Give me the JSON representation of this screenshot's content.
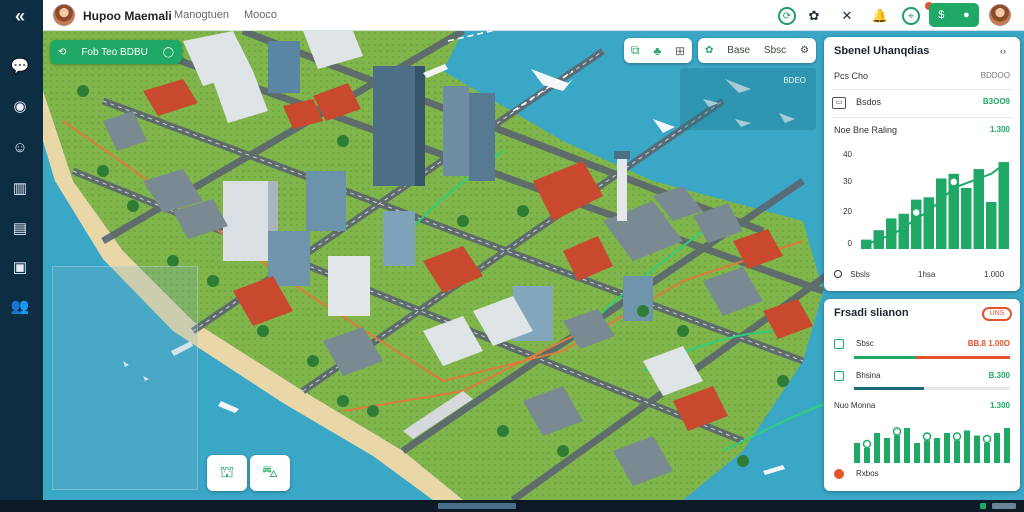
{
  "header": {
    "brand": "Hupoo Maemali",
    "nav": [
      {
        "label": "Manogtuen"
      },
      {
        "label": "Mooco"
      }
    ]
  },
  "map": {
    "search_chip": {
      "label": "Fob Teo BDBU"
    },
    "filter_chip": {
      "label_a": "Base",
      "label_b": "Sbsc"
    },
    "flights_label": "BDEO"
  },
  "panel_traffic": {
    "title": "Sbenel Uhanqdias",
    "close": "‹›",
    "sub_label": "Pcs Cho",
    "sub_value": "BDDOO",
    "rows": [
      {
        "label": "Bsdos",
        "value": "B3OO9"
      }
    ],
    "chart_title": "Noe Bne Raling",
    "chart_value": "1.300",
    "legend": [
      {
        "label": "Sbsls"
      },
      {
        "label": "1hsa"
      },
      {
        "label": "1.000"
      }
    ]
  },
  "panel_status": {
    "title": "Frsadi slianon",
    "pill": "UNS",
    "rows": [
      {
        "label": "Sbsc",
        "v1": "BB.8",
        "v2": "1.00O"
      },
      {
        "label": "Bhsina",
        "v1": "",
        "v2": "B.300"
      },
      {
        "label": "Nuo Monna",
        "v1": "",
        "v2": "1.300"
      }
    ],
    "footer": "Rxbos"
  },
  "colors": {
    "accent": "#1fa866",
    "alert": "#e5532b",
    "rail": "#0c2d42",
    "sea": "#3aa7c7"
  },
  "chart_data": [
    {
      "type": "bar",
      "title": "Noe Bne Raling",
      "ylabel": "",
      "xlabel": "",
      "ylim": [
        0,
        40
      ],
      "yticks": [
        0,
        20,
        30,
        40
      ],
      "series": [
        {
          "values": [
            4,
            8,
            13,
            15,
            21,
            22,
            30,
            32,
            26,
            34,
            20,
            37
          ]
        }
      ],
      "trend": [
        2,
        4,
        6,
        9,
        13,
        16,
        21,
        26,
        28,
        30,
        32,
        36
      ]
    },
    {
      "type": "bar",
      "title": "",
      "series": [
        {
          "values": [
            8,
            6,
            12,
            10,
            11,
            14,
            8,
            9,
            10,
            12,
            9,
            13,
            11,
            8,
            12,
            14
          ]
        }
      ],
      "ylim": [
        0,
        16
      ]
    }
  ]
}
